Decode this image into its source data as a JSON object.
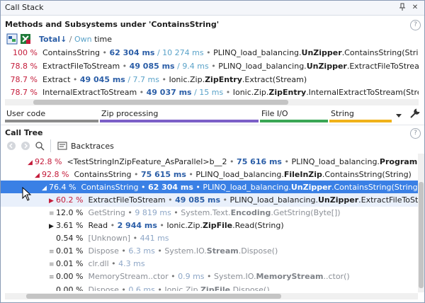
{
  "window": {
    "title": "Call Stack"
  },
  "methods": {
    "header": "Methods and Subsystems under 'ContainsString'",
    "mode": {
      "total": "Total",
      "arrow": "↓",
      "slash": " / ",
      "own": "Own",
      "suffix": " time"
    },
    "rows": [
      {
        "pct": "100 %",
        "name": "ContainsString",
        "ms": "62 304 ms",
        "own": "10 274 ms",
        "ns": "PLINQ_load_balancing.",
        "cls": "UnZipper",
        "rest": ".ContainsString(String,"
      },
      {
        "pct": "78.8 %",
        "name": "ExtractFileToStream",
        "ms": "49 085 ms",
        "own": "9.4 ms",
        "ns": "PLINQ_load_balancing.",
        "cls": "UnZipper",
        "rest": ".ExtractFileToStream(St"
      },
      {
        "pct": "78.7 %",
        "name": "Extract",
        "ms": "49 045 ms",
        "own": "7.7 ms",
        "ns": "Ionic.Zip.",
        "cls": "ZipEntry",
        "rest": ".Extract(Stream)"
      },
      {
        "pct": "78.7 %",
        "name": "InternalExtractToStream",
        "ms": "49 037 ms",
        "own": "15 ms",
        "ns": "Ionic.Zip.",
        "cls": "ZipEntry",
        "rest": ".InternalExtractToStream(Stream,"
      }
    ]
  },
  "categories": [
    {
      "label": "User code",
      "color": "#8c8c8c"
    },
    {
      "label": "Zip processing",
      "color": "#7b5fc7"
    },
    {
      "label": "File I/O",
      "color": "#3aa655"
    },
    {
      "label": "String",
      "color": "#f0b21a"
    }
  ],
  "calltree": {
    "header": "Call Tree",
    "backtraces": "Backtraces",
    "rows": [
      {
        "pct": "92.8 %",
        "name": "<TestStringInZipFeature_AsParallel>b__2",
        "ms": "75 616 ms",
        "ns": "PLINQ_load_balancing.",
        "cls": "Program",
        "rest": "+<>"
      },
      {
        "pct": "92.8 %",
        "name": "ContainsString",
        "ms": "75 615 ms",
        "ns": "PLINQ_load_balancing.",
        "cls": "FileInZip",
        "rest": ".ContainsString(String)"
      },
      {
        "pct": "76.4 %",
        "name": "ContainsString",
        "ms": "62 304 ms",
        "ns": "PLINQ_load_balancing.",
        "cls": "UnZipper",
        "rest": ".ContainsString(String, Str"
      },
      {
        "pct": "60.2 %",
        "name": "ExtractFileToStream",
        "ms": "49 085 ms",
        "ns": "PLINQ_load_balancing.",
        "cls": "UnZipper",
        "rest": ".ExtractFileToStream"
      },
      {
        "pct": "12.0 %",
        "name": "GetString",
        "ms": "9 819 ms",
        "ns": "System.Text.",
        "cls": "Encoding",
        "rest": ".GetString(Byte[])"
      },
      {
        "pct": "3.61 %",
        "name": "Read",
        "ms": "2 944 ms",
        "ns": "Ionic.Zip.",
        "cls": "ZipFile",
        "rest": ".Read(String)"
      },
      {
        "pct": "0.54 %",
        "name": "[Unknown]",
        "ms": "441 ms",
        "ns": "",
        "cls": "",
        "rest": ""
      },
      {
        "pct": "0.01 %",
        "name": "Dispose",
        "ms": "6.3 ms",
        "ns": "System.IO.",
        "cls": "Stream",
        "rest": ".Dispose()"
      },
      {
        "pct": "0.01 %",
        "name": "clr.dll",
        "ms": "4.3 ms",
        "ns": "",
        "cls": "",
        "rest": ""
      },
      {
        "pct": "0.00 %",
        "name": "MemoryStream..ctor",
        "ms": "0.9 ms",
        "ns": "System.IO.",
        "cls": "MemoryStream",
        "rest": "..ctor()"
      },
      {
        "pct": "0.00 %",
        "name": "Dispose",
        "ms": "0.6 ms",
        "ns": "Ionic.Zip.",
        "cls": "ZipFile",
        "rest": ".Dispose()"
      }
    ]
  },
  "icons": {
    "pin": "pin-icon",
    "close": "close-icon",
    "help": "help-icon"
  },
  "glyphs": {
    "pin": "📌",
    "close": "✕",
    "help": "?",
    "sep": " • ",
    "slash": " / "
  }
}
